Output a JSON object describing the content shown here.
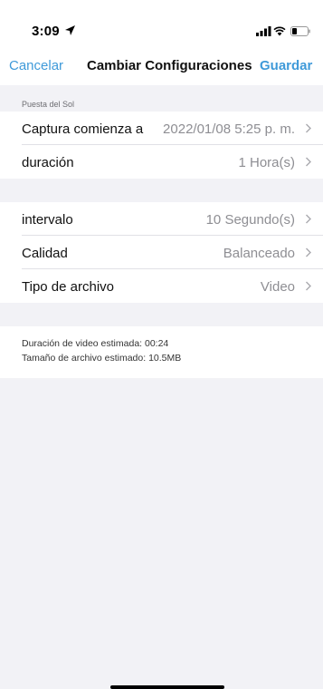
{
  "status_bar": {
    "time": "3:09"
  },
  "nav": {
    "cancel": "Cancelar",
    "title": "Cambiar Configuraciones",
    "save": "Guardar"
  },
  "section": {
    "header": "Puesta del Sol"
  },
  "group1": [
    {
      "label": "Captura comienza a",
      "value": "2022/01/08 5:25 p. m."
    },
    {
      "label": "duración",
      "value": "1 Hora(s)"
    }
  ],
  "group2": [
    {
      "label": "intervalo",
      "value": "10 Segundo(s)"
    },
    {
      "label": "Calidad",
      "value": "Balanceado"
    },
    {
      "label": "Tipo de archivo",
      "value": "Video"
    }
  ],
  "info": {
    "video_duration": "Duración de video estimada: 00:24",
    "file_size": "Tamaño de archivo estimado: 10.5MB"
  },
  "colors": {
    "accent": "#3f9ad9",
    "background": "#f2f2f6",
    "value_gray": "#8e8e93"
  },
  "icons": [
    "location-arrow-icon",
    "cellular-signal-icon",
    "wifi-icon",
    "battery-icon",
    "chevron-right-icon"
  ]
}
